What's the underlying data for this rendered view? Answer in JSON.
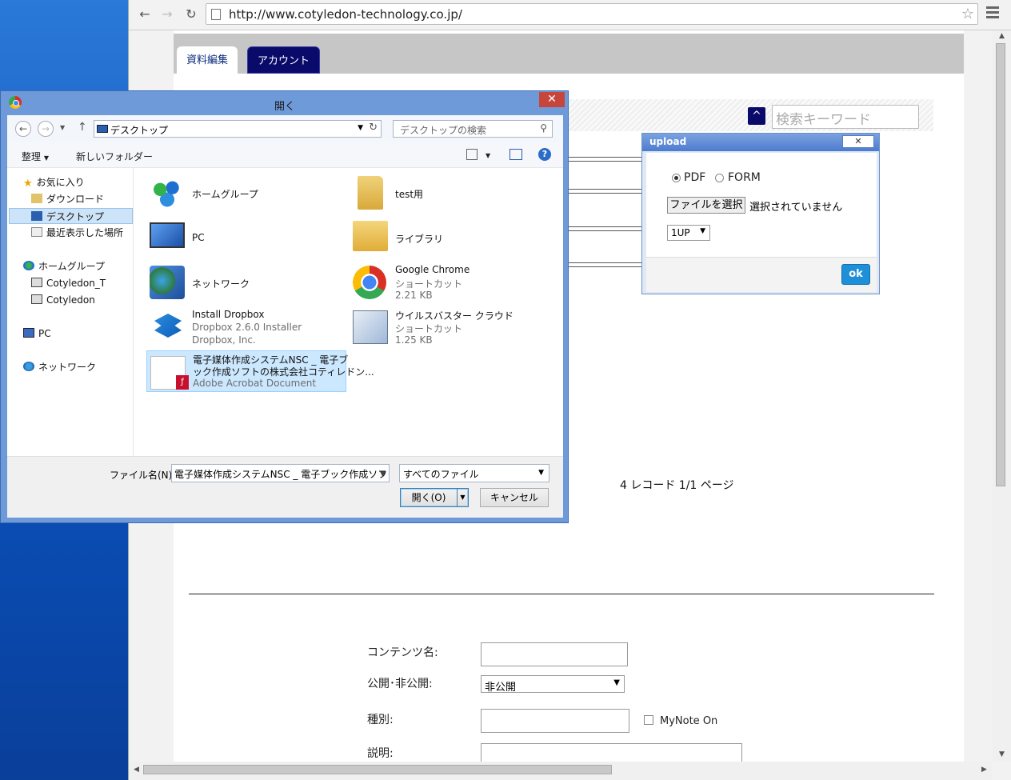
{
  "browser": {
    "url": "http://www.cotyledon-technology.co.jp/"
  },
  "page": {
    "tabs": [
      {
        "label": "資料編集"
      },
      {
        "label": "アカウント"
      }
    ],
    "search_placeholder": "検索キーワード",
    "sort_button": "^",
    "pager": "4 レコード 1/1 ページ",
    "form": {
      "content_name_label": "コンテンツ名:",
      "publish_label": "公開･非公開:",
      "publish_value": "非公開",
      "type_label": "種別:",
      "mynote_label": "MyNote On",
      "description_label": "説明:"
    }
  },
  "upload_dialog": {
    "title": "upload",
    "close": "✕",
    "radio_pdf": "PDF",
    "radio_form": "FORM",
    "selected_format": "PDF",
    "choose_file": "ファイルを選択",
    "no_file": "選択されていません",
    "layout_value": "1UP",
    "ok": "ok"
  },
  "open_dialog": {
    "title": "開く",
    "address": "デスクトップ",
    "search_placeholder": "デスクトップの検索",
    "organize": "整理",
    "new_folder": "新しいフォルダー",
    "nav": {
      "favorites": "お気に入り",
      "downloads": "ダウンロード",
      "desktop": "デスクトップ",
      "recent": "最近表示した場所",
      "homegroup": "ホームグループ",
      "user1": "Cotyledon_T",
      "user2": "Cotyledon",
      "pc": "PC",
      "network": "ネットワーク"
    },
    "items": [
      {
        "name": "ホームグループ",
        "icon": "homegroup-icon"
      },
      {
        "name": "test用",
        "icon": "user-folder-icon"
      },
      {
        "name": "PC",
        "icon": "computer-icon"
      },
      {
        "name": "ライブラリ",
        "icon": "library-icon"
      },
      {
        "name": "ネットワーク",
        "icon": "network-icon"
      },
      {
        "name": "Google Chrome",
        "sub1": "ショートカット",
        "sub2": "2.21 KB",
        "icon": "chrome-icon"
      },
      {
        "name": "Install Dropbox",
        "sub1": "Dropbox 2.6.0 Installer",
        "sub2": "Dropbox, Inc.",
        "icon": "dropbox-icon"
      },
      {
        "name": "ウイルスバスター クラウド",
        "sub1": "ショートカット",
        "sub2": "1.25 KB",
        "icon": "virusbuster-icon"
      },
      {
        "name": "電子媒体作成システムNSC _ 電子ブ",
        "name2": "ック作成ソフトの株式会社コティレドン...",
        "sub1": "Adobe Acrobat Document",
        "icon": "pdf-icon"
      }
    ],
    "filename_label": "ファイル名(N):",
    "filename_value": "電子媒体作成システムNSC _ 電子ブック作成ソフトの",
    "filetype_value": "すべてのファイル",
    "open_button": "開く(O)",
    "cancel_button": "キャンセル"
  },
  "colors": {
    "tab_active_bg": "#0a0a6a",
    "ok_button": "#1e90d8",
    "dialog_frame": "#6f9ad9",
    "close_button": "#c7463c"
  }
}
